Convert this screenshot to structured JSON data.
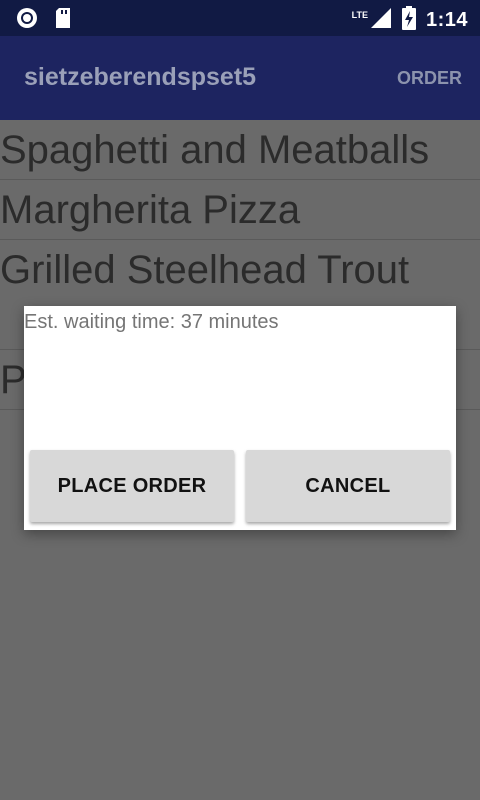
{
  "status_bar": {
    "network_label": "LTE",
    "time": "1:14",
    "icons": [
      "record-icon",
      "sd-card-icon",
      "signal-icon",
      "battery-charging-icon"
    ]
  },
  "app_bar": {
    "title": "sietzeberendspset5",
    "action_label": "ORDER"
  },
  "menu_items": [
    "Spaghetti and Meatballs",
    "Margherita Pizza",
    "Grilled Steelhead Trout",
    "P"
  ],
  "dialog": {
    "message": "Est. waiting time: 37 minutes",
    "place_order_label": "PLACE ORDER",
    "cancel_label": "CANCEL"
  },
  "colors": {
    "status_bar": "#111a44",
    "app_bar": "#1d2460",
    "scrim": "#6a6a6a",
    "dialog": "#ffffff",
    "button": "#d8d8d8"
  }
}
